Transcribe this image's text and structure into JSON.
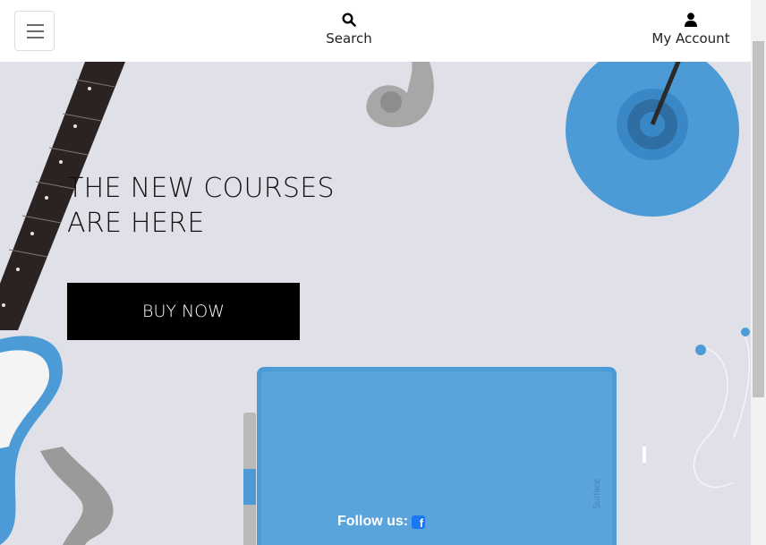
{
  "header": {
    "menu_icon": "hamburger-icon",
    "search": {
      "icon": "search-icon",
      "label": "Search"
    },
    "account": {
      "icon": "user-icon",
      "label": "My Account"
    }
  },
  "hero": {
    "title": "THE NEW COURSES\nARE HERE",
    "cta_label": "BUY NOW",
    "follow_label": "Follow us:",
    "social_icon": "facebook-icon",
    "colors": {
      "background": "#e0e1e8",
      "accent_blue": "#4d9bd6",
      "button": "#000000"
    }
  }
}
